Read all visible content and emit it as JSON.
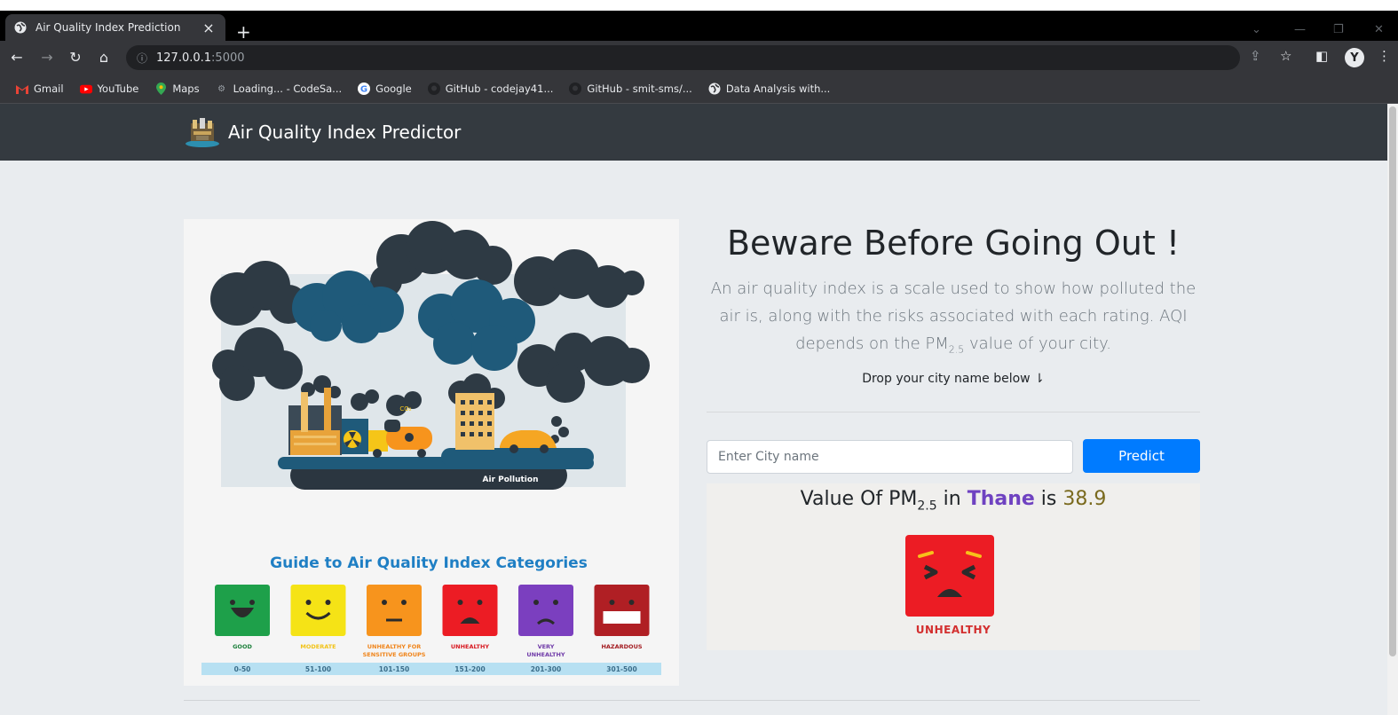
{
  "browser": {
    "tab_title": "Air Quality Index Prediction",
    "tab_close": "×",
    "new_tab": "+",
    "url_host": "127.0.0.1",
    "url_port": ":5000",
    "bookmarks": [
      {
        "label": "Gmail",
        "icon": "gmail-icon"
      },
      {
        "label": "YouTube",
        "icon": "youtube-icon"
      },
      {
        "label": "Maps",
        "icon": "maps-icon"
      },
      {
        "label": "Loading... - CodeSa...",
        "icon": "loading-icon"
      },
      {
        "label": "Google",
        "icon": "google-icon"
      },
      {
        "label": "GitHub - codejay41...",
        "icon": "github-icon"
      },
      {
        "label": "GitHub - smit-sms/...",
        "icon": "github-icon"
      },
      {
        "label": "Data Analysis with...",
        "icon": "globe-icon"
      }
    ],
    "profile_initial": "Y"
  },
  "navbar": {
    "brand": "Air Quality Index Predictor"
  },
  "hero": {
    "heading": "Beware Before Going Out !",
    "lead_part1": "An air quality index is a scale used to show how polluted the air is, along with the risks associated with each rating. AQI depends on the PM",
    "lead_sub": "2.5",
    "lead_part2": " value of your city.",
    "drop_text": "Drop your city name below ⇂"
  },
  "illustration": {
    "banner_text": "Air Pollution",
    "co2_text": "CO₂",
    "guide_title": "Guide to Air Quality Index Categories",
    "categories": [
      {
        "label": "GOOD",
        "range": "0-50",
        "color": "#1ea04a",
        "label_color": "#1a7f3a"
      },
      {
        "label": "MODERATE",
        "range": "51-100",
        "color": "#f5e316",
        "label_color": "#f2c318"
      },
      {
        "label": "UNHEALTHY FOR SENSITIVE GROUPS",
        "range": "101-150",
        "color": "#f7941d",
        "label_color": "#f0851b"
      },
      {
        "label": "UNHEALTHY",
        "range": "151-200",
        "color": "#ec1c24",
        "label_color": "#d81a22"
      },
      {
        "label": "VERY UNHEALTHY",
        "range": "201-300",
        "color": "#7b3fbf",
        "label_color": "#6f3aa8"
      },
      {
        "label": "HAZARDOUS",
        "range": "301-500",
        "color": "#b01f24",
        "label_color": "#a31b20"
      }
    ]
  },
  "form": {
    "placeholder": "Enter City name",
    "button_label": "Predict"
  },
  "result": {
    "prefix": "Value Of PM",
    "sub": "2.5",
    "in_word": " in ",
    "city": "Thane",
    "is_word": " is ",
    "value": "38.9",
    "category": "UNHEALTHY",
    "category_color": "#ec1c24"
  }
}
